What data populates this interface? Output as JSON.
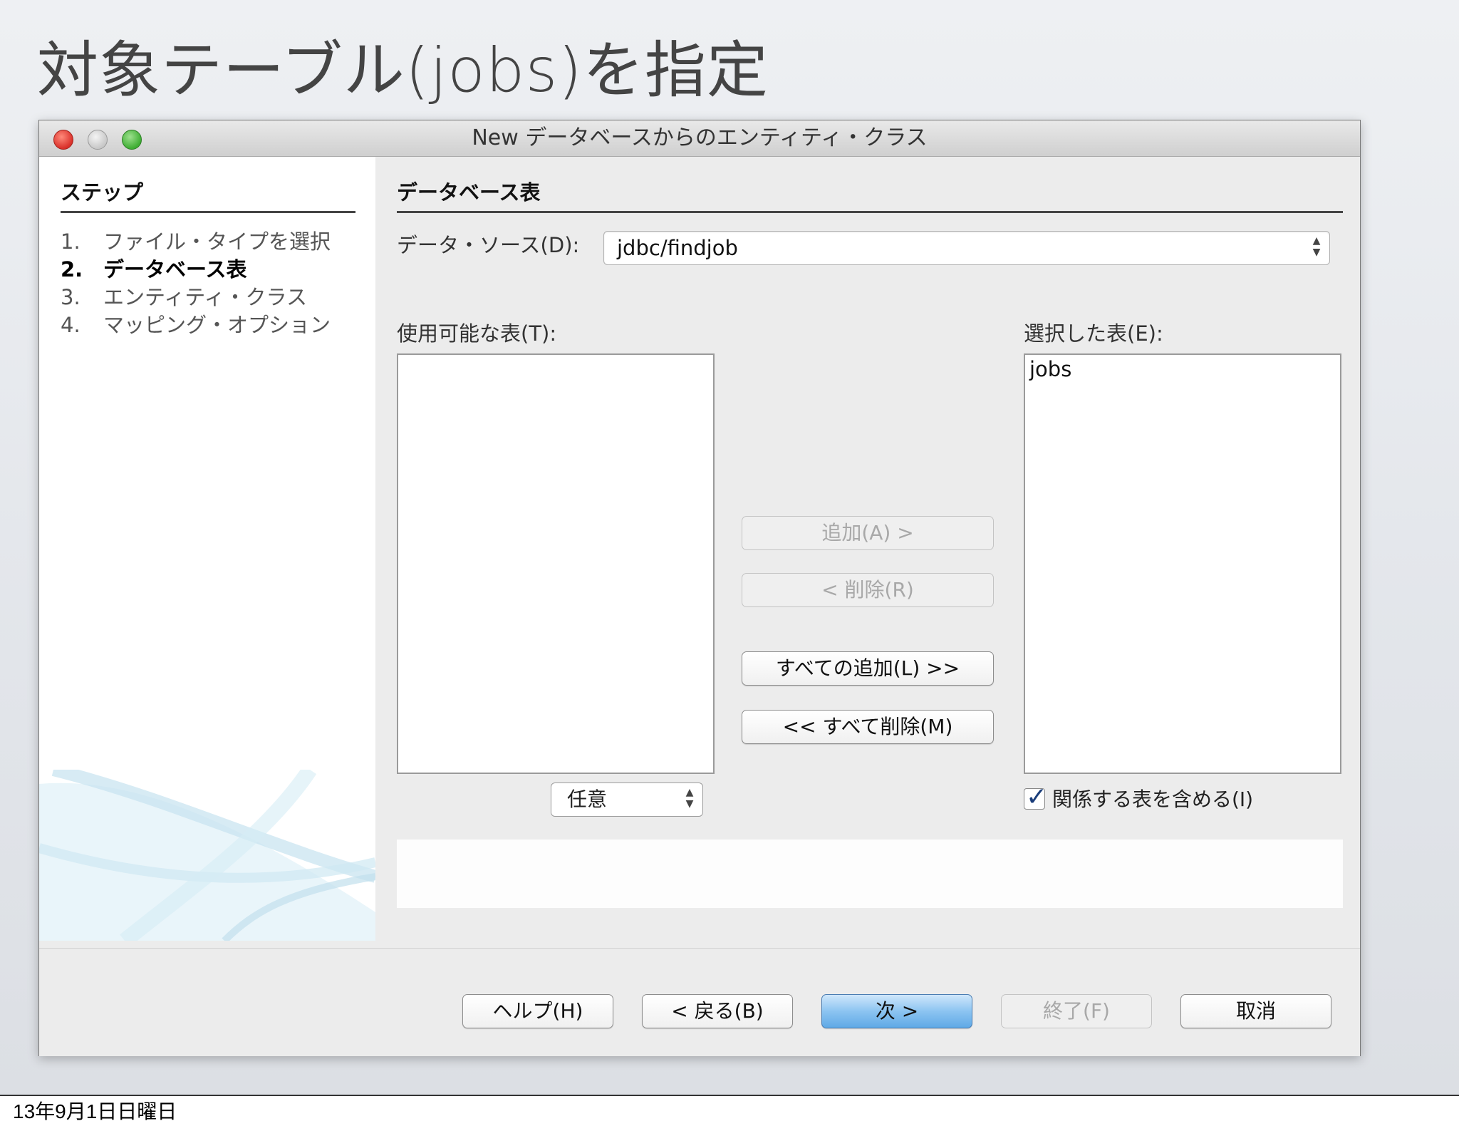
{
  "slide": {
    "title": "対象テーブル(jobs)を指定",
    "footer_date": "13年9月1日日曜日"
  },
  "window": {
    "title": "New データベースからのエンティティ・クラス"
  },
  "steps": {
    "heading": "ステップ",
    "items": [
      {
        "num": "1.",
        "label": "ファイル・タイプを選択"
      },
      {
        "num": "2.",
        "label": "データベース表"
      },
      {
        "num": "3.",
        "label": "エンティティ・クラス"
      },
      {
        "num": "4.",
        "label": "マッピング・オプション"
      }
    ],
    "active_index": 1
  },
  "panel": {
    "heading": "データベース表",
    "data_source_label": "データ・ソース(D):",
    "data_source_value": "jdbc/findjob",
    "available_label": "使用可能な表(T):",
    "selected_label": "選択した表(E):",
    "selected_items": [
      "jobs"
    ],
    "filter_value": "任意",
    "include_related_label": "関係する表を含める(I)",
    "include_related_checked": true
  },
  "transfer_buttons": {
    "add": "追加(A) >",
    "remove": "< 削除(R)",
    "add_all": "すべての追加(L) >>",
    "remove_all": "<< すべて削除(M)"
  },
  "footer_buttons": {
    "help": "ヘルプ(H)",
    "back": "< 戻る(B)",
    "next": "次 >",
    "finish": "終了(F)",
    "cancel": "取消"
  },
  "colors": {
    "primary_button": "#8cc4f1",
    "close_button": "#d9302a",
    "zoom_button": "#3fae34"
  }
}
